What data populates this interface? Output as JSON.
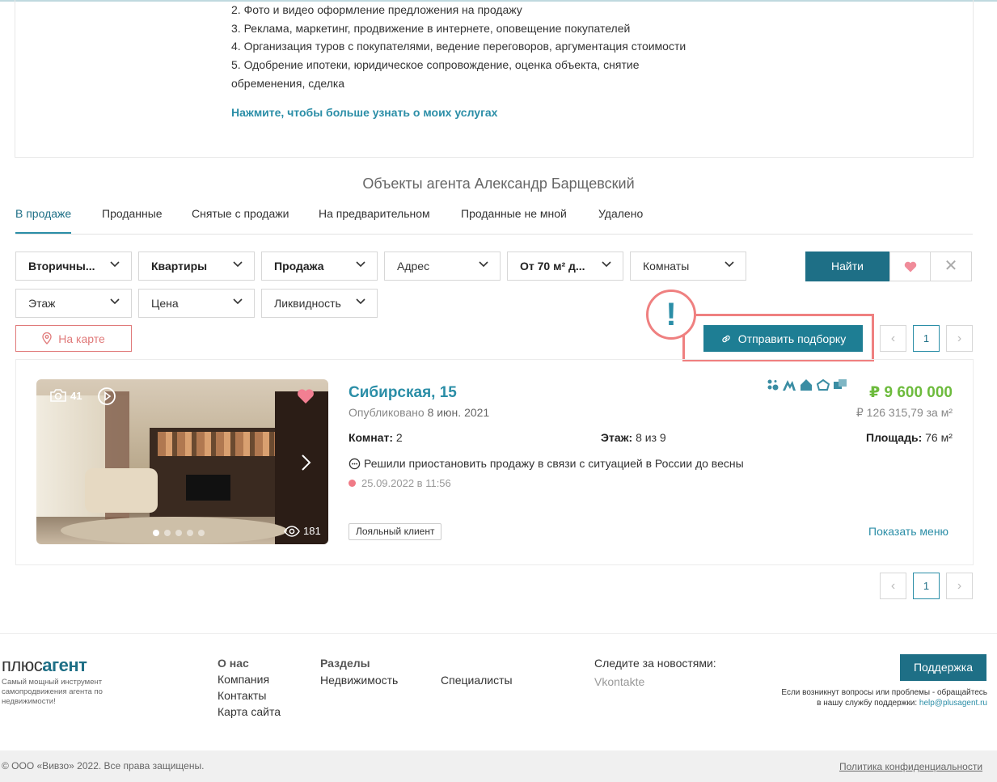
{
  "services": {
    "lines": [
      "2. Фото и видео оформление предложения на продажу",
      "3. Реклама, маркетинг, продвижение в интернете, оповещение покупателей",
      "4. Организация туров с покупателями, ведение  переговоров, аргументация стоимости",
      "5. Одобрение ипотеки, юридическое сопровождение, оценка объекта, снятие",
      "обременения, сделка"
    ],
    "more_link": "Нажмите, чтобы больше узнать о моих услугах"
  },
  "section_title": "Объекты агента Александр Барщевский",
  "tabs": [
    {
      "label": "В продаже",
      "active": true
    },
    {
      "label": "Проданные"
    },
    {
      "label": "Снятые с продажи"
    },
    {
      "label": "На предварительном"
    },
    {
      "label": "Проданные не мной"
    },
    {
      "label": "Удалено"
    }
  ],
  "filters": {
    "row1": [
      {
        "label": "Вторичны..."
      },
      {
        "label": "Квартиры"
      },
      {
        "label": "Продажа"
      },
      {
        "label": "Адрес"
      },
      {
        "label": "От 70 м² д..."
      },
      {
        "label": "Комнаты"
      }
    ],
    "row2": [
      {
        "label": "Этаж"
      },
      {
        "label": "Цена"
      },
      {
        "label": "Ликвидность"
      }
    ],
    "find_label": "Найти",
    "clear_label": "✕"
  },
  "map_button": "На карте",
  "annotation_mark": "!",
  "send_button": "Отправить подборку",
  "pagination": {
    "prev": "‹",
    "current": "1",
    "next": "›"
  },
  "listing": {
    "photo_count": "41",
    "views": "181",
    "photo_dots": 5,
    "title": "Сибирская, 15",
    "published_label": "Опубликовано",
    "published_date": "8 июн. 2021",
    "price": "₽ 9 600 000",
    "price_per_m2": "₽ 126 315,79 за м²",
    "rooms_label": "Комнат:",
    "rooms": "2",
    "floor_label": "Этаж:",
    "floor": "8 из 9",
    "area_label": "Площадь:",
    "area": "76 м²",
    "note": "Решили приостановить продажу в связи с ситуацией в России до весны",
    "status_time": "25.09.2022 в 11:56",
    "badge": "Лояльный клиент",
    "show_menu": "Показать меню",
    "accent_color": "#2b8ea7",
    "price_color": "#6dbb3d"
  },
  "footer": {
    "logo_light": "плюс",
    "logo_bold": "агент",
    "tagline": "Самый мощный инструмент самопродвижения агента по недвижимости!",
    "about_head": "О нас",
    "about_links": [
      "Компания",
      "Контакты",
      "Карта сайта"
    ],
    "sections_head": "Разделы",
    "sections_links": [
      "Недвижимость",
      "Специалисты"
    ],
    "follow": "Следите за новостями:",
    "vk": "Vkontakte",
    "support_button": "Поддержка",
    "support_text_1": "Если возникнут вопросы или проблемы - обращайтесь",
    "support_text_2": "в нашу службу поддержки:",
    "support_email": "help@plusagent.ru",
    "copyright": "© ООО «Вивзо» 2022. Все права защищены.",
    "policy": "Политика конфиденциальности"
  }
}
